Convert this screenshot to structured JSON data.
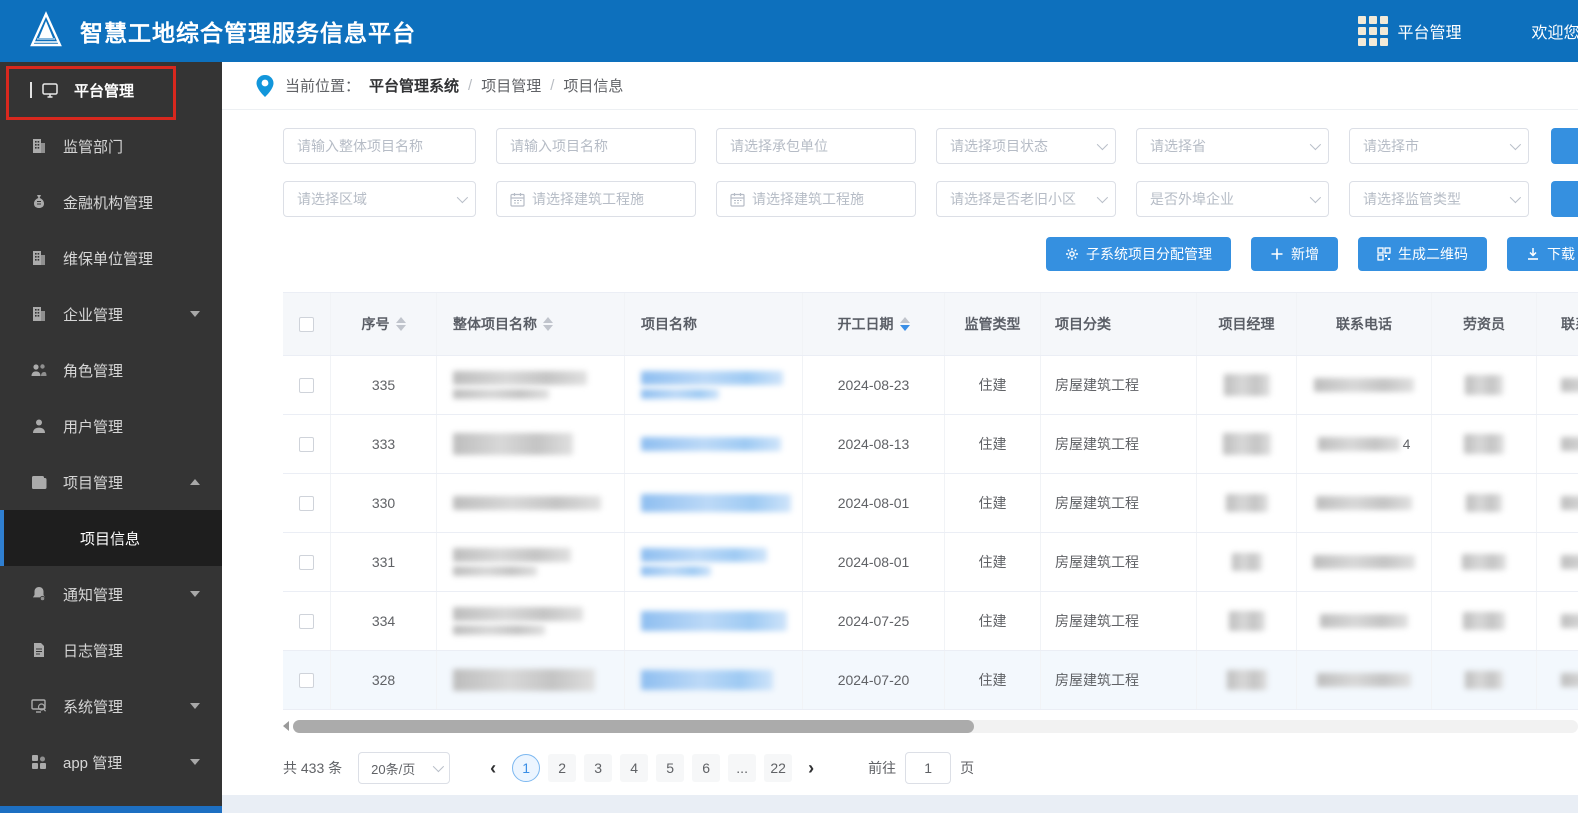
{
  "header": {
    "title": "智慧工地综合管理服务信息平台",
    "nav_label": "平台管理",
    "welcome": "欢迎您:"
  },
  "sidebar": {
    "items": [
      {
        "label": "平台管理",
        "icon": "monitor"
      },
      {
        "label": "监管部门",
        "icon": "building"
      },
      {
        "label": "金融机构管理",
        "icon": "money-bag"
      },
      {
        "label": "维保单位管理",
        "icon": "building"
      },
      {
        "label": "企业管理",
        "icon": "building",
        "expandable": true
      },
      {
        "label": "角色管理",
        "icon": "users"
      },
      {
        "label": "用户管理",
        "icon": "user"
      },
      {
        "label": "项目管理",
        "icon": "folder",
        "expanded": true
      },
      {
        "label": "通知管理",
        "icon": "bell",
        "expandable": true
      },
      {
        "label": "日志管理",
        "icon": "document"
      },
      {
        "label": "系统管理",
        "icon": "monitor-search",
        "expandable": true
      },
      {
        "label": "app 管理",
        "icon": "app-grid",
        "expandable": true
      }
    ],
    "submenu": {
      "label": "项目信息",
      "active": true
    }
  },
  "breadcrumb": {
    "prefix": "当前位置：",
    "root": "平台管理系统",
    "sep": "/",
    "level1": "项目管理",
    "level2": "项目信息"
  },
  "filters": {
    "row1": [
      {
        "placeholder": "请输入整体项目名称"
      },
      {
        "placeholder": "请输入项目名称"
      },
      {
        "placeholder": "请选择承包单位"
      },
      {
        "placeholder": "请选择项目状态"
      },
      {
        "placeholder": "请选择省"
      },
      {
        "placeholder": "请选择市"
      }
    ],
    "row2": [
      {
        "placeholder": "请选择区域"
      },
      {
        "placeholder": "请选择建筑工程施"
      },
      {
        "placeholder": "请选择建筑工程施"
      },
      {
        "placeholder": "请选择是否老旧小区"
      },
      {
        "placeholder": "是否外埠企业"
      },
      {
        "placeholder": "请选择监管类型"
      }
    ]
  },
  "actions": {
    "assign": "子系统项目分配管理",
    "add": "新增",
    "qrcode": "生成二维码",
    "download": "下载"
  },
  "table": {
    "columns": {
      "seq": "序号",
      "overall_name": "整体项目名称",
      "project_name": "项目名称",
      "start_date": "开工日期",
      "supervise_type": "监管类型",
      "category": "项目分类",
      "manager": "项目经理",
      "phone": "联系电话",
      "labor_officer": "劳资员",
      "phone2": "联系电话"
    },
    "sort": {
      "start_date": "desc"
    },
    "rows": [
      {
        "seq": "335",
        "date": "2024-08-23",
        "type": "住建",
        "category": "房屋建筑工程"
      },
      {
        "seq": "333",
        "date": "2024-08-13",
        "type": "住建",
        "category": "房屋建筑工程",
        "phone_visible": "4"
      },
      {
        "seq": "330",
        "date": "2024-08-01",
        "type": "住建",
        "category": "房屋建筑工程"
      },
      {
        "seq": "331",
        "date": "2024-08-01",
        "type": "住建",
        "category": "房屋建筑工程"
      },
      {
        "seq": "334",
        "date": "2024-07-25",
        "type": "住建",
        "category": "房屋建筑工程"
      },
      {
        "seq": "328",
        "date": "2024-07-20",
        "type": "住建",
        "category": "房屋建筑工程"
      }
    ]
  },
  "pagination": {
    "total": "共 433 条",
    "page_size": "20条/页",
    "prev": "‹",
    "next": "›",
    "pages": [
      "1",
      "2",
      "3",
      "4",
      "5",
      "6",
      "...",
      "22"
    ],
    "current": "1",
    "goto_label": "前往",
    "goto_value": "1",
    "goto_suffix": "页"
  },
  "colors": {
    "header_blue": "#0d70bd",
    "button_blue": "#3590e0",
    "sidebar_dark": "#343434",
    "accent_sort": "#3a8ee6",
    "annotation_red": "#d8281e"
  }
}
